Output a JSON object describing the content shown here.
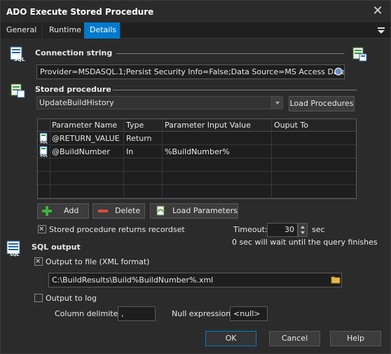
{
  "window": {
    "title": "ADO Execute Stored Procedure"
  },
  "tabs": [
    {
      "label": "General"
    },
    {
      "label": "Runtime"
    },
    {
      "label": "Details"
    }
  ],
  "connection": {
    "label": "Connection string",
    "value": "Provider=MSDASQL.1;Persist Security Info=False;Data Source=MS Access Database"
  },
  "procedure": {
    "label": "Stored procedure",
    "selected": "UpdateBuildHistory",
    "load_button": "Load Procedures"
  },
  "params": {
    "columns": [
      "Parameter Name",
      "Type",
      "Parameter Input Value",
      "Ouput To"
    ],
    "rows": [
      {
        "name": "@RETURN_VALUE",
        "type": "Return",
        "value": "",
        "output": ""
      },
      {
        "name": "@BuildNumber",
        "type": "In",
        "value": "%BuildNumber%",
        "output": ""
      }
    ]
  },
  "actions": {
    "add": "Add",
    "delete": "Delete",
    "load_params": "Load Parameters"
  },
  "recordset": {
    "label": "Stored procedure returns recordset",
    "checked": true
  },
  "timeout": {
    "label": "Timeout:",
    "value": "30",
    "unit": "sec",
    "hint": "0 sec will wait until the query finishes"
  },
  "sql_output": {
    "label": "SQL output",
    "to_file_label": "Output to file (XML format)",
    "to_file_checked": true,
    "file_path": "C:\\BuildResults\\Build%BuildNumber%.xml",
    "to_log_label": "Output to log",
    "to_log_checked": false,
    "col_delim_label": "Column delimiter",
    "col_delim_value": ",",
    "null_label": "Null expression",
    "null_value": "<null>"
  },
  "footer": {
    "ok": "OK",
    "cancel": "Cancel",
    "help": "Help"
  },
  "colors": {
    "accent": "#007acc",
    "background": "#2b2b2b",
    "green": "#3db33d",
    "red": "#e04a3a"
  }
}
